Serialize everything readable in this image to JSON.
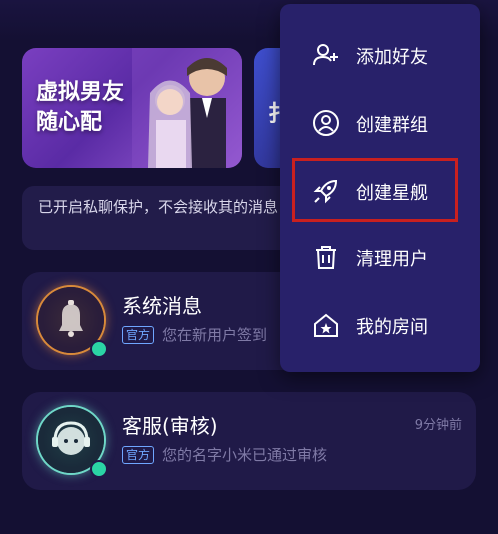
{
  "banner": {
    "title_line1": "虚拟男友",
    "title_line2": "随心配",
    "second_banner_text": "扌"
  },
  "notice": {
    "text": "已开启私聊保护，不会接收其的消息"
  },
  "chats": [
    {
      "title": "系统消息",
      "tag": "官方",
      "subtitle": "您在新用户签到",
      "time": ""
    },
    {
      "title": "客服(审核)",
      "tag": "官方",
      "subtitle": "您的名字小米已通过审核",
      "time": "9分钟前"
    }
  ],
  "menu": {
    "items": [
      {
        "label": "添加好友",
        "icon": "add-friend-icon"
      },
      {
        "label": "创建群组",
        "icon": "group-icon"
      },
      {
        "label": "创建星舰",
        "icon": "rocket-icon"
      },
      {
        "label": "清理用户",
        "icon": "trash-icon"
      },
      {
        "label": "我的房间",
        "icon": "home-icon"
      }
    ]
  },
  "colors": {
    "background": "#141033",
    "menu_bg": "#28216a",
    "highlight": "#c9201f",
    "online_dot": "#2bd4a5"
  }
}
